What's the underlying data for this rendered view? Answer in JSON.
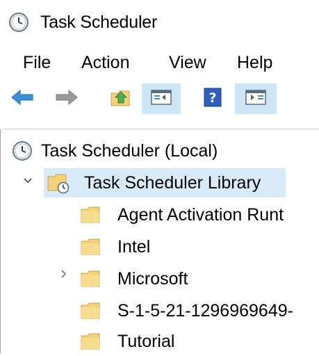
{
  "window": {
    "title": "Task Scheduler",
    "title_icon": "clock-icon"
  },
  "menu": {
    "items": [
      "File",
      "Action",
      "View",
      "Help"
    ]
  },
  "toolbar": {
    "buttons": [
      {
        "name": "back-button",
        "icon": "arrow-left-icon"
      },
      {
        "name": "forward-button",
        "icon": "arrow-right-icon"
      },
      {
        "name": "up-one-level-button",
        "icon": "folder-up-icon"
      },
      {
        "name": "show-hide-console-tree-button",
        "icon": "console-tree-icon"
      },
      {
        "name": "help-button",
        "icon": "help-icon"
      },
      {
        "name": "show-hide-action-pane-button",
        "icon": "action-pane-icon"
      }
    ]
  },
  "tree": {
    "root": {
      "label": "Task Scheduler (Local)",
      "icon": "clock-icon"
    },
    "library": {
      "label": "Task Scheduler Library",
      "icon": "folder-clock-icon",
      "expanded": true,
      "selected": true
    },
    "children": [
      {
        "label": "Agent Activation Runt",
        "expandable": false
      },
      {
        "label": "Intel",
        "expandable": false
      },
      {
        "label": "Microsoft",
        "expandable": true
      },
      {
        "label": "S-1-5-21-1296969649-",
        "expandable": false
      },
      {
        "label": "Tutorial",
        "expandable": false
      }
    ]
  },
  "colors": {
    "accent": "#3b8fd6",
    "selection": "#d9ebf9",
    "toolbar_highlight": "#cde6f7",
    "folder": "#f3d27a"
  }
}
